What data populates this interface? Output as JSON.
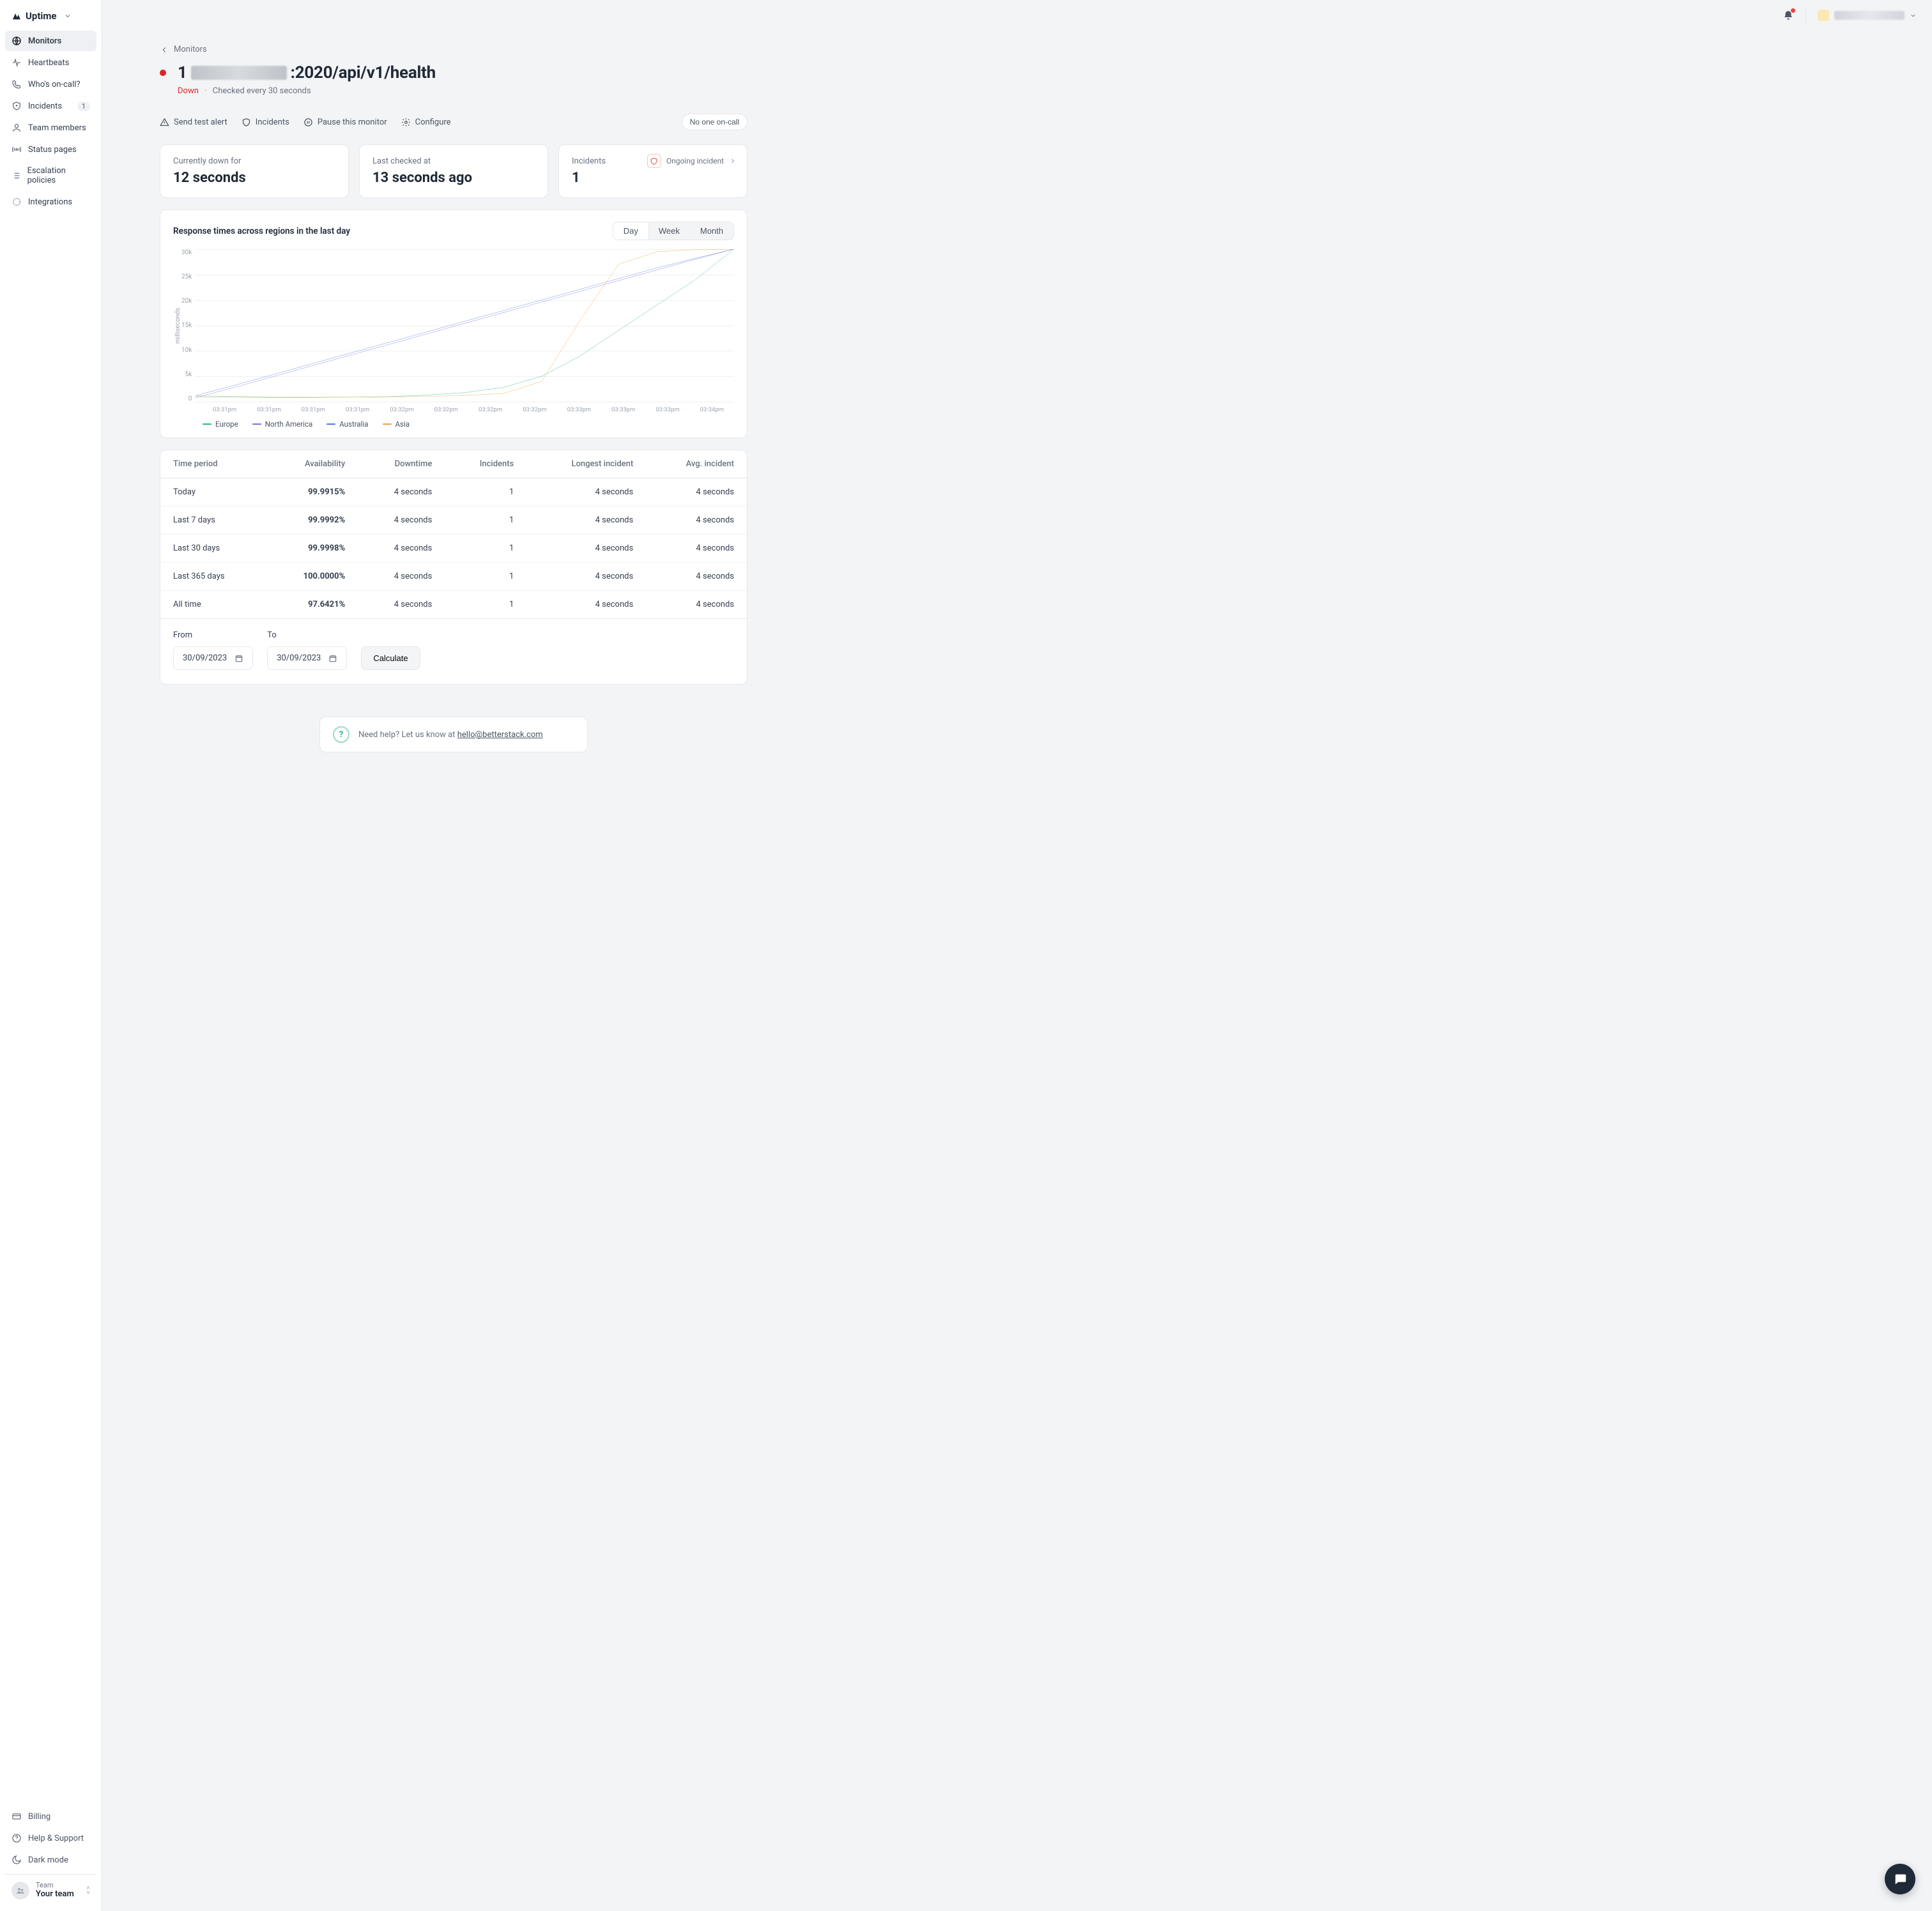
{
  "brand": "Uptime",
  "sidebar": {
    "items": [
      {
        "label": "Monitors",
        "icon": "globe",
        "active": true
      },
      {
        "label": "Heartbeats",
        "icon": "pulse"
      },
      {
        "label": "Who's on-call?",
        "icon": "phone"
      },
      {
        "label": "Incidents",
        "icon": "shield",
        "badge": "1"
      },
      {
        "label": "Team members",
        "icon": "user"
      },
      {
        "label": "Status pages",
        "icon": "broadcast"
      },
      {
        "label": "Escalation policies",
        "icon": "list"
      },
      {
        "label": "Integrations",
        "icon": "puzzle"
      }
    ],
    "bottom": [
      {
        "label": "Billing",
        "icon": "card"
      },
      {
        "label": "Help & Support",
        "icon": "help"
      },
      {
        "label": "Dark mode",
        "icon": "moon"
      }
    ],
    "team": {
      "label": "Team",
      "name": "Your team"
    }
  },
  "breadcrumb": "Monitors",
  "monitor": {
    "title_prefix": "1",
    "title_suffix": ":2020/api/v1/health",
    "status": "Down",
    "check_interval": "Checked every 30 seconds"
  },
  "actions": {
    "send_test": "Send test alert",
    "incidents": "Incidents",
    "pause": "Pause this monitor",
    "configure": "Configure",
    "no_one": "No one on-call"
  },
  "stats": {
    "down_label": "Currently down for",
    "down_value": "12 seconds",
    "checked_label": "Last checked at",
    "checked_value": "13 seconds ago",
    "incidents_label": "Incidents",
    "incidents_value": "1",
    "ongoing": "Ongoing incident"
  },
  "chart": {
    "title": "Response times across regions in the last day",
    "tabs": [
      "Day",
      "Week",
      "Month"
    ],
    "active_tab": "Day",
    "y_label": "milliseconds",
    "legend": [
      {
        "name": "Europe",
        "color": "#2fb380"
      },
      {
        "name": "North America",
        "color": "#7c6fd9"
      },
      {
        "name": "Australia",
        "color": "#4f76e6"
      },
      {
        "name": "Asia",
        "color": "#e8a33d"
      }
    ]
  },
  "chart_data": {
    "type": "line",
    "ylabel": "milliseconds",
    "ylim": [
      0,
      30000
    ],
    "y_ticks": [
      "30k",
      "25k",
      "20k",
      "15k",
      "10k",
      "5k",
      "0"
    ],
    "x_ticks": [
      "03:31pm",
      "03:31pm",
      "03:31pm",
      "03:31pm",
      "03:32pm",
      "03:32pm",
      "03:32pm",
      "03:32pm",
      "03:33pm",
      "03:33pm",
      "03:33pm",
      "03:34pm"
    ],
    "series": [
      {
        "name": "Europe",
        "color": "#2fb380",
        "values": [
          1000,
          900,
          850,
          850,
          900,
          1000,
          1300,
          1800,
          2800,
          5000,
          9000,
          14000,
          19000,
          24000,
          30000
        ]
      },
      {
        "name": "North America",
        "color": "#7c6fd9",
        "values": [
          800,
          2800,
          4900,
          7000,
          9100,
          11200,
          13300,
          15400,
          17500,
          19600,
          21700,
          23800,
          25900,
          28000,
          30000
        ]
      },
      {
        "name": "Australia",
        "color": "#4f76e6",
        "values": [
          1200,
          3200,
          5300,
          7400,
          9500,
          11600,
          13700,
          15800,
          17900,
          20000,
          22100,
          24200,
          26300,
          28200,
          30000
        ]
      },
      {
        "name": "Asia",
        "color": "#e8a33d",
        "values": [
          1200,
          1050,
          950,
          900,
          900,
          950,
          1050,
          1250,
          1600,
          4000,
          16000,
          27000,
          29500,
          29900,
          30000
        ]
      }
    ]
  },
  "table": {
    "headers": [
      "Time period",
      "Availability",
      "Downtime",
      "Incidents",
      "Longest incident",
      "Avg. incident"
    ],
    "rows": [
      [
        "Today",
        "99.9915%",
        "4 seconds",
        "1",
        "4 seconds",
        "4 seconds"
      ],
      [
        "Last 7 days",
        "99.9992%",
        "4 seconds",
        "1",
        "4 seconds",
        "4 seconds"
      ],
      [
        "Last 30 days",
        "99.9998%",
        "4 seconds",
        "1",
        "4 seconds",
        "4 seconds"
      ],
      [
        "Last 365 days",
        "100.0000%",
        "4 seconds",
        "1",
        "4 seconds",
        "4 seconds"
      ],
      [
        "All time",
        "97.6421%",
        "4 seconds",
        "1",
        "4 seconds",
        "4 seconds"
      ]
    ]
  },
  "date_range": {
    "from_label": "From",
    "from_value": "30/09/2023",
    "to_label": "To",
    "to_value": "30/09/2023",
    "calc": "Calculate"
  },
  "help": {
    "text": "Need help? Let us know at ",
    "email": "hello@betterstack.com"
  }
}
